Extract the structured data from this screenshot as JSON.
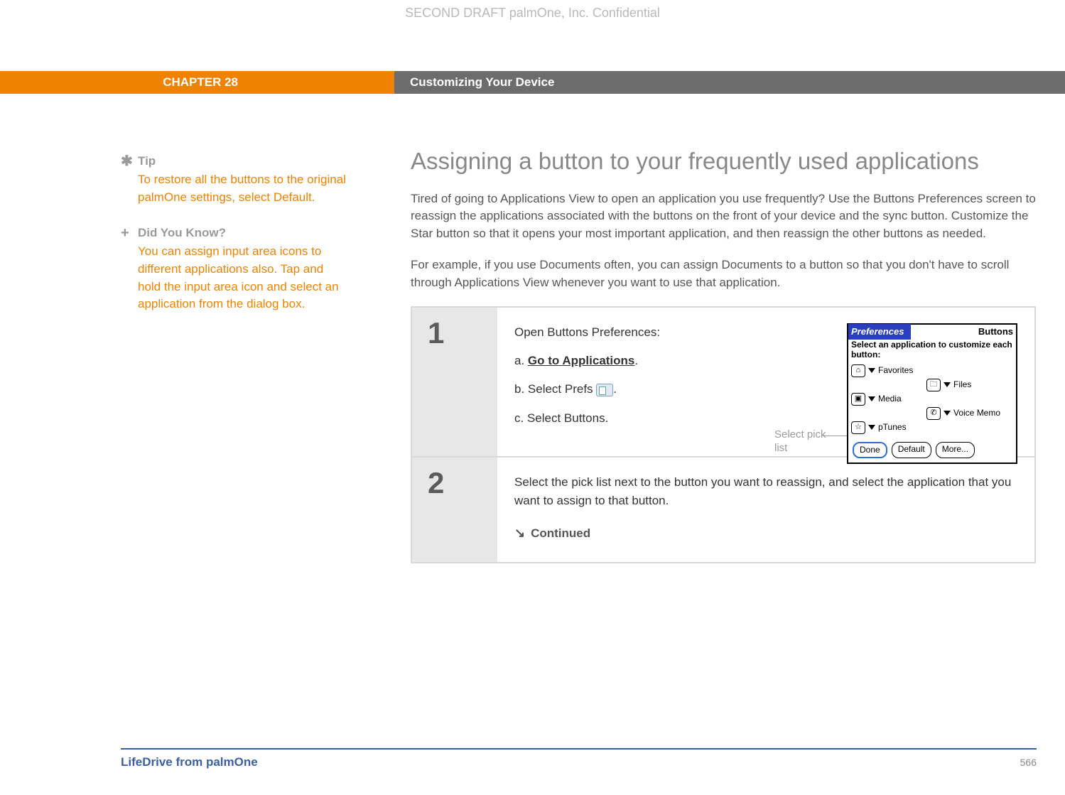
{
  "watermark": "SECOND DRAFT palmOne, Inc.  Confidential",
  "chapter": {
    "label": "CHAPTER 28",
    "title": "Customizing Your Device"
  },
  "sidebar": {
    "tip": {
      "heading": "Tip",
      "body": "To restore all the buttons to the original palmOne settings, select Default."
    },
    "dyk": {
      "heading": "Did You Know?",
      "body": "You can assign input area icons to different applications also. Tap and hold the input area icon and select an application from the dialog box."
    }
  },
  "main": {
    "heading": "Assigning a button to your frequently used applications",
    "para1": "Tired of going to Applications View to open an application you use frequently? Use the Buttons Preferences screen to reassign the applications associated with the buttons on the front of your device and the sync button. Customize the Star button so that it opens your most important application, and then reassign the other buttons as needed.",
    "para2": "For example, if you use Documents often, you can assign Documents to a button so that you don't have to scroll through Applications View whenever you want to use that application."
  },
  "step1": {
    "num": "1",
    "title": "Open Buttons Preferences:",
    "a_prefix": "a.  ",
    "a_link": "Go to Applications",
    "a_suffix": ".",
    "b_prefix": "b.  Select Prefs ",
    "b_suffix": ".",
    "c": "c.  Select Buttons.",
    "callout": "Select pick list"
  },
  "palm": {
    "title_left": "Preferences",
    "title_right": "Buttons",
    "subtitle": "Select an application to customize each button:",
    "rows": [
      {
        "icon": "⌂",
        "label": "Favorites"
      },
      {
        "icon": "🗀",
        "label": "Files"
      },
      {
        "icon": "▣",
        "label": "Media"
      },
      {
        "icon": "✆",
        "label": "Voice Memo"
      },
      {
        "icon": "☆",
        "label": "pTunes"
      }
    ],
    "buttons": {
      "done": "Done",
      "default": "Default",
      "more": "More..."
    }
  },
  "step2": {
    "num": "2",
    "text": "Select the pick list next to the button you want to reassign, and select the application that you want to assign to that button.",
    "continued": "Continued"
  },
  "footer": {
    "product": "LifeDrive from palmOne",
    "page": "566"
  }
}
